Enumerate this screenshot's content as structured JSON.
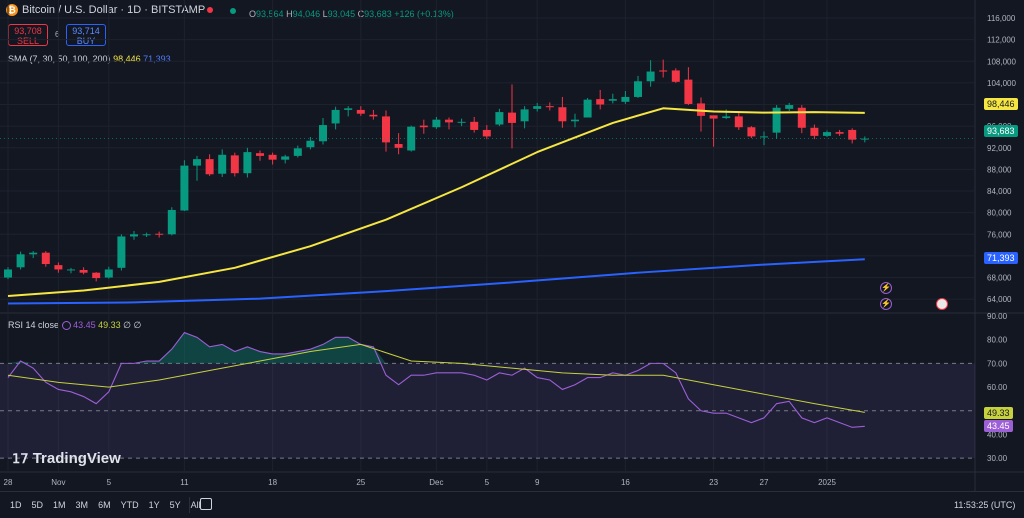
{
  "header": {
    "coin_glyph": "₿",
    "symbol": "Bitcoin / U.S. Dollar · 1D · BITSTAMP",
    "open_label": "O",
    "open": "93,564",
    "high_label": "H",
    "high": "94,046",
    "low_label": "L",
    "low": "93,045",
    "close_label": "C",
    "close": "93,683",
    "change": "+126 (+0.13%)"
  },
  "trade": {
    "sell_price": "93,708",
    "sell_label": "SELL",
    "spread": "6",
    "buy_price": "93,714",
    "buy_label": "BUY"
  },
  "sma_legend": {
    "label": "SMA (7, 30, 50, 100, 200)",
    "value1": "98,446",
    "value2": "71,393"
  },
  "rsi_legend": {
    "label": "RSI 14 close",
    "value1": "43.45",
    "value2": "49.33",
    "value3": "∅",
    "value4": "∅"
  },
  "price_tags": {
    "sma_yellow": "98,446",
    "last": "93,683",
    "sma_blue": "71,393",
    "rsi_ma": "49.33",
    "rsi": "43.45"
  },
  "time_label": "11:53:25 (UTC)",
  "watermark": "TradingView",
  "range_buttons": [
    "1D",
    "5D",
    "1M",
    "3M",
    "6M",
    "YTD",
    "1Y",
    "5Y",
    "All"
  ],
  "colors": {
    "up": "#089981",
    "down": "#f23645",
    "sma_yellow": "#f5e642",
    "sma_blue": "#2962ff",
    "rsi": "#9c5fd6",
    "rsi_ma": "#c7d13e"
  },
  "chart_data": [
    {
      "type": "candlestick",
      "title": "Bitcoin / U.S. Dollar · 1D · BITSTAMP",
      "ylim": [
        62000,
        116000
      ],
      "y_ticks": [
        "116,000",
        "112,000",
        "108,000",
        "104,000",
        "100,000",
        "96,000",
        "92,000",
        "88,000",
        "84,000",
        "80,000",
        "76,000",
        "72,000",
        "68,000",
        "64,000"
      ],
      "y_tick_values": [
        116000,
        112000,
        108000,
        104000,
        100000,
        96000,
        92000,
        88000,
        84000,
        80000,
        76000,
        72000,
        68000,
        64000
      ],
      "x_ticks": [
        "28",
        "Nov",
        "5",
        "11",
        "18",
        "25",
        "Dec",
        "5",
        "9",
        "16",
        "23",
        "27",
        "2025"
      ],
      "x_tick_days": [
        0,
        4,
        8,
        14,
        21,
        28,
        34,
        38,
        42,
        49,
        56,
        60,
        65
      ],
      "candles": [
        [
          0,
          68000,
          69500,
          67700,
          69900
        ],
        [
          1,
          69900,
          72300,
          69500,
          72800
        ],
        [
          2,
          72300,
          72600,
          71600,
          72900
        ],
        [
          3,
          72600,
          70500,
          70000,
          72900
        ],
        [
          4,
          70300,
          69500,
          68900,
          70800
        ],
        [
          5,
          69500,
          69500,
          68800,
          69800
        ],
        [
          6,
          69400,
          68900,
          68600,
          69900
        ],
        [
          7,
          68900,
          67900,
          67300,
          69000
        ],
        [
          8,
          68000,
          69500,
          67800,
          70000
        ],
        [
          9,
          69800,
          75600,
          69300,
          76000
        ],
        [
          10,
          75600,
          76000,
          75000,
          76600
        ],
        [
          11,
          75900,
          76000,
          75500,
          76300
        ],
        [
          12,
          76100,
          76000,
          75400,
          76500
        ],
        [
          13,
          76000,
          80500,
          75800,
          81000
        ],
        [
          14,
          80400,
          88700,
          80300,
          89700
        ],
        [
          15,
          88700,
          89900,
          85900,
          90500
        ],
        [
          16,
          89900,
          87100,
          86800,
          90800
        ],
        [
          17,
          87200,
          90700,
          86600,
          91700
        ],
        [
          18,
          90600,
          87300,
          86700,
          91100
        ],
        [
          19,
          87300,
          91200,
          86500,
          92000
        ],
        [
          20,
          91000,
          90500,
          89600,
          91500
        ],
        [
          21,
          90700,
          89800,
          88900,
          91100
        ],
        [
          22,
          89800,
          90400,
          89100,
          90700
        ],
        [
          23,
          90500,
          91900,
          90200,
          92400
        ],
        [
          24,
          92100,
          93300,
          91700,
          94000
        ],
        [
          25,
          93200,
          96200,
          92600,
          97500
        ],
        [
          26,
          96500,
          99000,
          95400,
          99600
        ],
        [
          27,
          99000,
          99300,
          97800,
          99700
        ],
        [
          28,
          99000,
          98300,
          97900,
          99700
        ],
        [
          29,
          98100,
          97800,
          97200,
          99000
        ],
        [
          30,
          97800,
          93000,
          91300,
          98900
        ],
        [
          31,
          92700,
          92000,
          90800,
          94700
        ],
        [
          32,
          91500,
          95900,
          91300,
          96100
        ],
        [
          33,
          96100,
          95800,
          94600,
          97200
        ],
        [
          34,
          95800,
          97200,
          95500,
          97700
        ],
        [
          35,
          97200,
          96700,
          95400,
          97600
        ],
        [
          36,
          96800,
          96800,
          96000,
          97400
        ],
        [
          37,
          96800,
          95300,
          94800,
          97700
        ],
        [
          38,
          95300,
          94100,
          93600,
          96200
        ],
        [
          39,
          96300,
          98600,
          96000,
          99200
        ],
        [
          40,
          98500,
          96600,
          91900,
          103700
        ],
        [
          41,
          96900,
          99100,
          95600,
          99700
        ],
        [
          42,
          99200,
          99700,
          98700,
          100300
        ],
        [
          43,
          99700,
          99500,
          98900,
          100400
        ],
        [
          44,
          99500,
          96900,
          95700,
          101400
        ],
        [
          45,
          96900,
          97200,
          95800,
          98300
        ],
        [
          46,
          97600,
          100900,
          97600,
          101200
        ],
        [
          47,
          101000,
          100000,
          99100,
          102700
        ],
        [
          48,
          100700,
          101000,
          100200,
          102000
        ],
        [
          49,
          100500,
          101400,
          100100,
          102500
        ],
        [
          50,
          101400,
          104300,
          101200,
          105300
        ],
        [
          51,
          104300,
          106100,
          103300,
          108200
        ],
        [
          52,
          106300,
          106100,
          105000,
          108300
        ],
        [
          53,
          106300,
          104200,
          104000,
          106700
        ],
        [
          54,
          104600,
          100100,
          99900,
          106900
        ],
        [
          55,
          100200,
          97900,
          95000,
          101300
        ],
        [
          56,
          98000,
          97400,
          92200,
          97800
        ],
        [
          57,
          97500,
          97800,
          97300,
          99100
        ],
        [
          58,
          97800,
          95800,
          95300,
          98800
        ],
        [
          59,
          95800,
          94100,
          93800,
          96000
        ],
        [
          60,
          94000,
          94100,
          92500,
          95000
        ],
        [
          61,
          94800,
          99400,
          93700,
          99900
        ],
        [
          62,
          99200,
          99900,
          98800,
          100300
        ],
        [
          63,
          99400,
          95700,
          94700,
          99900
        ],
        [
          64,
          95700,
          94200,
          93600,
          96300
        ],
        [
          65,
          94200,
          94900,
          94000,
          95200
        ],
        [
          66,
          94900,
          94600,
          94200,
          95300
        ],
        [
          67,
          95300,
          93500,
          92800,
          95600
        ],
        [
          68,
          93600,
          93700,
          93000,
          94100
        ]
      ],
      "series": [
        {
          "name": "SMA",
          "color": "#f5e642",
          "x": [
            0,
            6,
            12,
            18,
            24,
            30,
            36,
            42,
            48,
            52,
            56,
            60,
            64,
            68
          ],
          "values": [
            64600,
            65600,
            67200,
            69800,
            73800,
            78700,
            84700,
            91200,
            96600,
            99300,
            98700,
            98500,
            98600,
            98446
          ]
        },
        {
          "name": "SMA",
          "color": "#2962ff",
          "x": [
            0,
            10,
            20,
            30,
            40,
            50,
            60,
            68
          ],
          "values": [
            63200,
            63400,
            64100,
            65500,
            67100,
            68900,
            70400,
            71393
          ]
        }
      ]
    },
    {
      "type": "line",
      "title": "RSI 14 close",
      "ylim": [
        25,
        90
      ],
      "y_ticks": [
        "90.00",
        "80.00",
        "70.00",
        "60.00",
        "50.00",
        "40.00",
        "30.00"
      ],
      "y_tick_values": [
        90,
        80,
        70,
        60,
        50,
        40,
        30
      ],
      "bands": {
        "upper": 70,
        "middle": 50,
        "lower": 30
      },
      "series": [
        {
          "name": "RSI",
          "color": "#9c5fd6",
          "x": [
            0,
            1,
            2,
            3,
            4,
            5,
            6,
            7,
            8,
            9,
            10,
            11,
            12,
            13,
            14,
            15,
            16,
            17,
            18,
            19,
            20,
            21,
            22,
            23,
            24,
            25,
            26,
            27,
            28,
            29,
            30,
            31,
            32,
            33,
            34,
            35,
            36,
            37,
            38,
            39,
            40,
            41,
            42,
            43,
            44,
            45,
            46,
            47,
            48,
            49,
            50,
            51,
            52,
            53,
            54,
            55,
            56,
            57,
            58,
            59,
            60,
            61,
            62,
            63,
            64,
            65,
            66,
            67,
            68
          ],
          "values": [
            64,
            71,
            68,
            62,
            59,
            58,
            56,
            53,
            58,
            70,
            70,
            71,
            71,
            76,
            83,
            81,
            77,
            78,
            75,
            77,
            75,
            74,
            74,
            75,
            76,
            78,
            81,
            81,
            78,
            77,
            65,
            61,
            65,
            65,
            66,
            66,
            66,
            65,
            63,
            66,
            65,
            68,
            64,
            63,
            59,
            61,
            64,
            64,
            66,
            65,
            67,
            70,
            70,
            66,
            55,
            50,
            49,
            49,
            47,
            45,
            47,
            53,
            54,
            47,
            45,
            47,
            45,
            43,
            43.45
          ]
        },
        {
          "name": "RSI",
          "color": "#c7d13e",
          "x": [
            0,
            4,
            8,
            12,
            16,
            20,
            24,
            28,
            32,
            36,
            40,
            44,
            48,
            52,
            56,
            60,
            64,
            68
          ],
          "values": [
            65,
            62,
            60,
            63,
            67,
            71,
            75,
            78,
            71,
            70,
            68,
            66,
            65,
            65,
            61,
            57,
            53,
            49.33
          ]
        }
      ]
    }
  ]
}
